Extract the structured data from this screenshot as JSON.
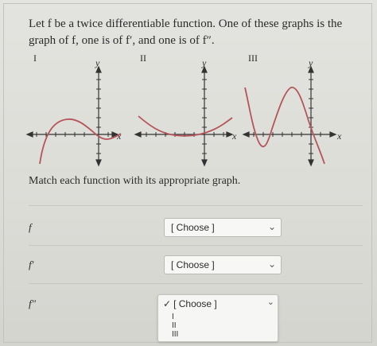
{
  "question": {
    "line1": "Let f be a twice differentiable function. One of these graphs is the",
    "line2": "graph of f, one is of f′, and one is of f″."
  },
  "graphs": [
    {
      "label": "I",
      "y_axis": "y",
      "x_axis": "x"
    },
    {
      "label": "II",
      "y_axis": "y",
      "x_axis": "x"
    },
    {
      "label": "III",
      "y_axis": "y",
      "x_axis": "x"
    }
  ],
  "match_prompt": "Match each function with its appropriate graph.",
  "rows": [
    {
      "label": "f",
      "value": "[ Choose ]"
    },
    {
      "label": "f′",
      "value": "[ Choose ]"
    },
    {
      "label": "f″",
      "value": "[ Choose ]"
    }
  ],
  "dropdown": {
    "selected": "[ Choose ]",
    "check": "✓",
    "options": [
      "I",
      "II",
      "III"
    ]
  },
  "colors": {
    "curve": "#b5555a",
    "axis": "#333333",
    "background": "#dcdcd8"
  }
}
